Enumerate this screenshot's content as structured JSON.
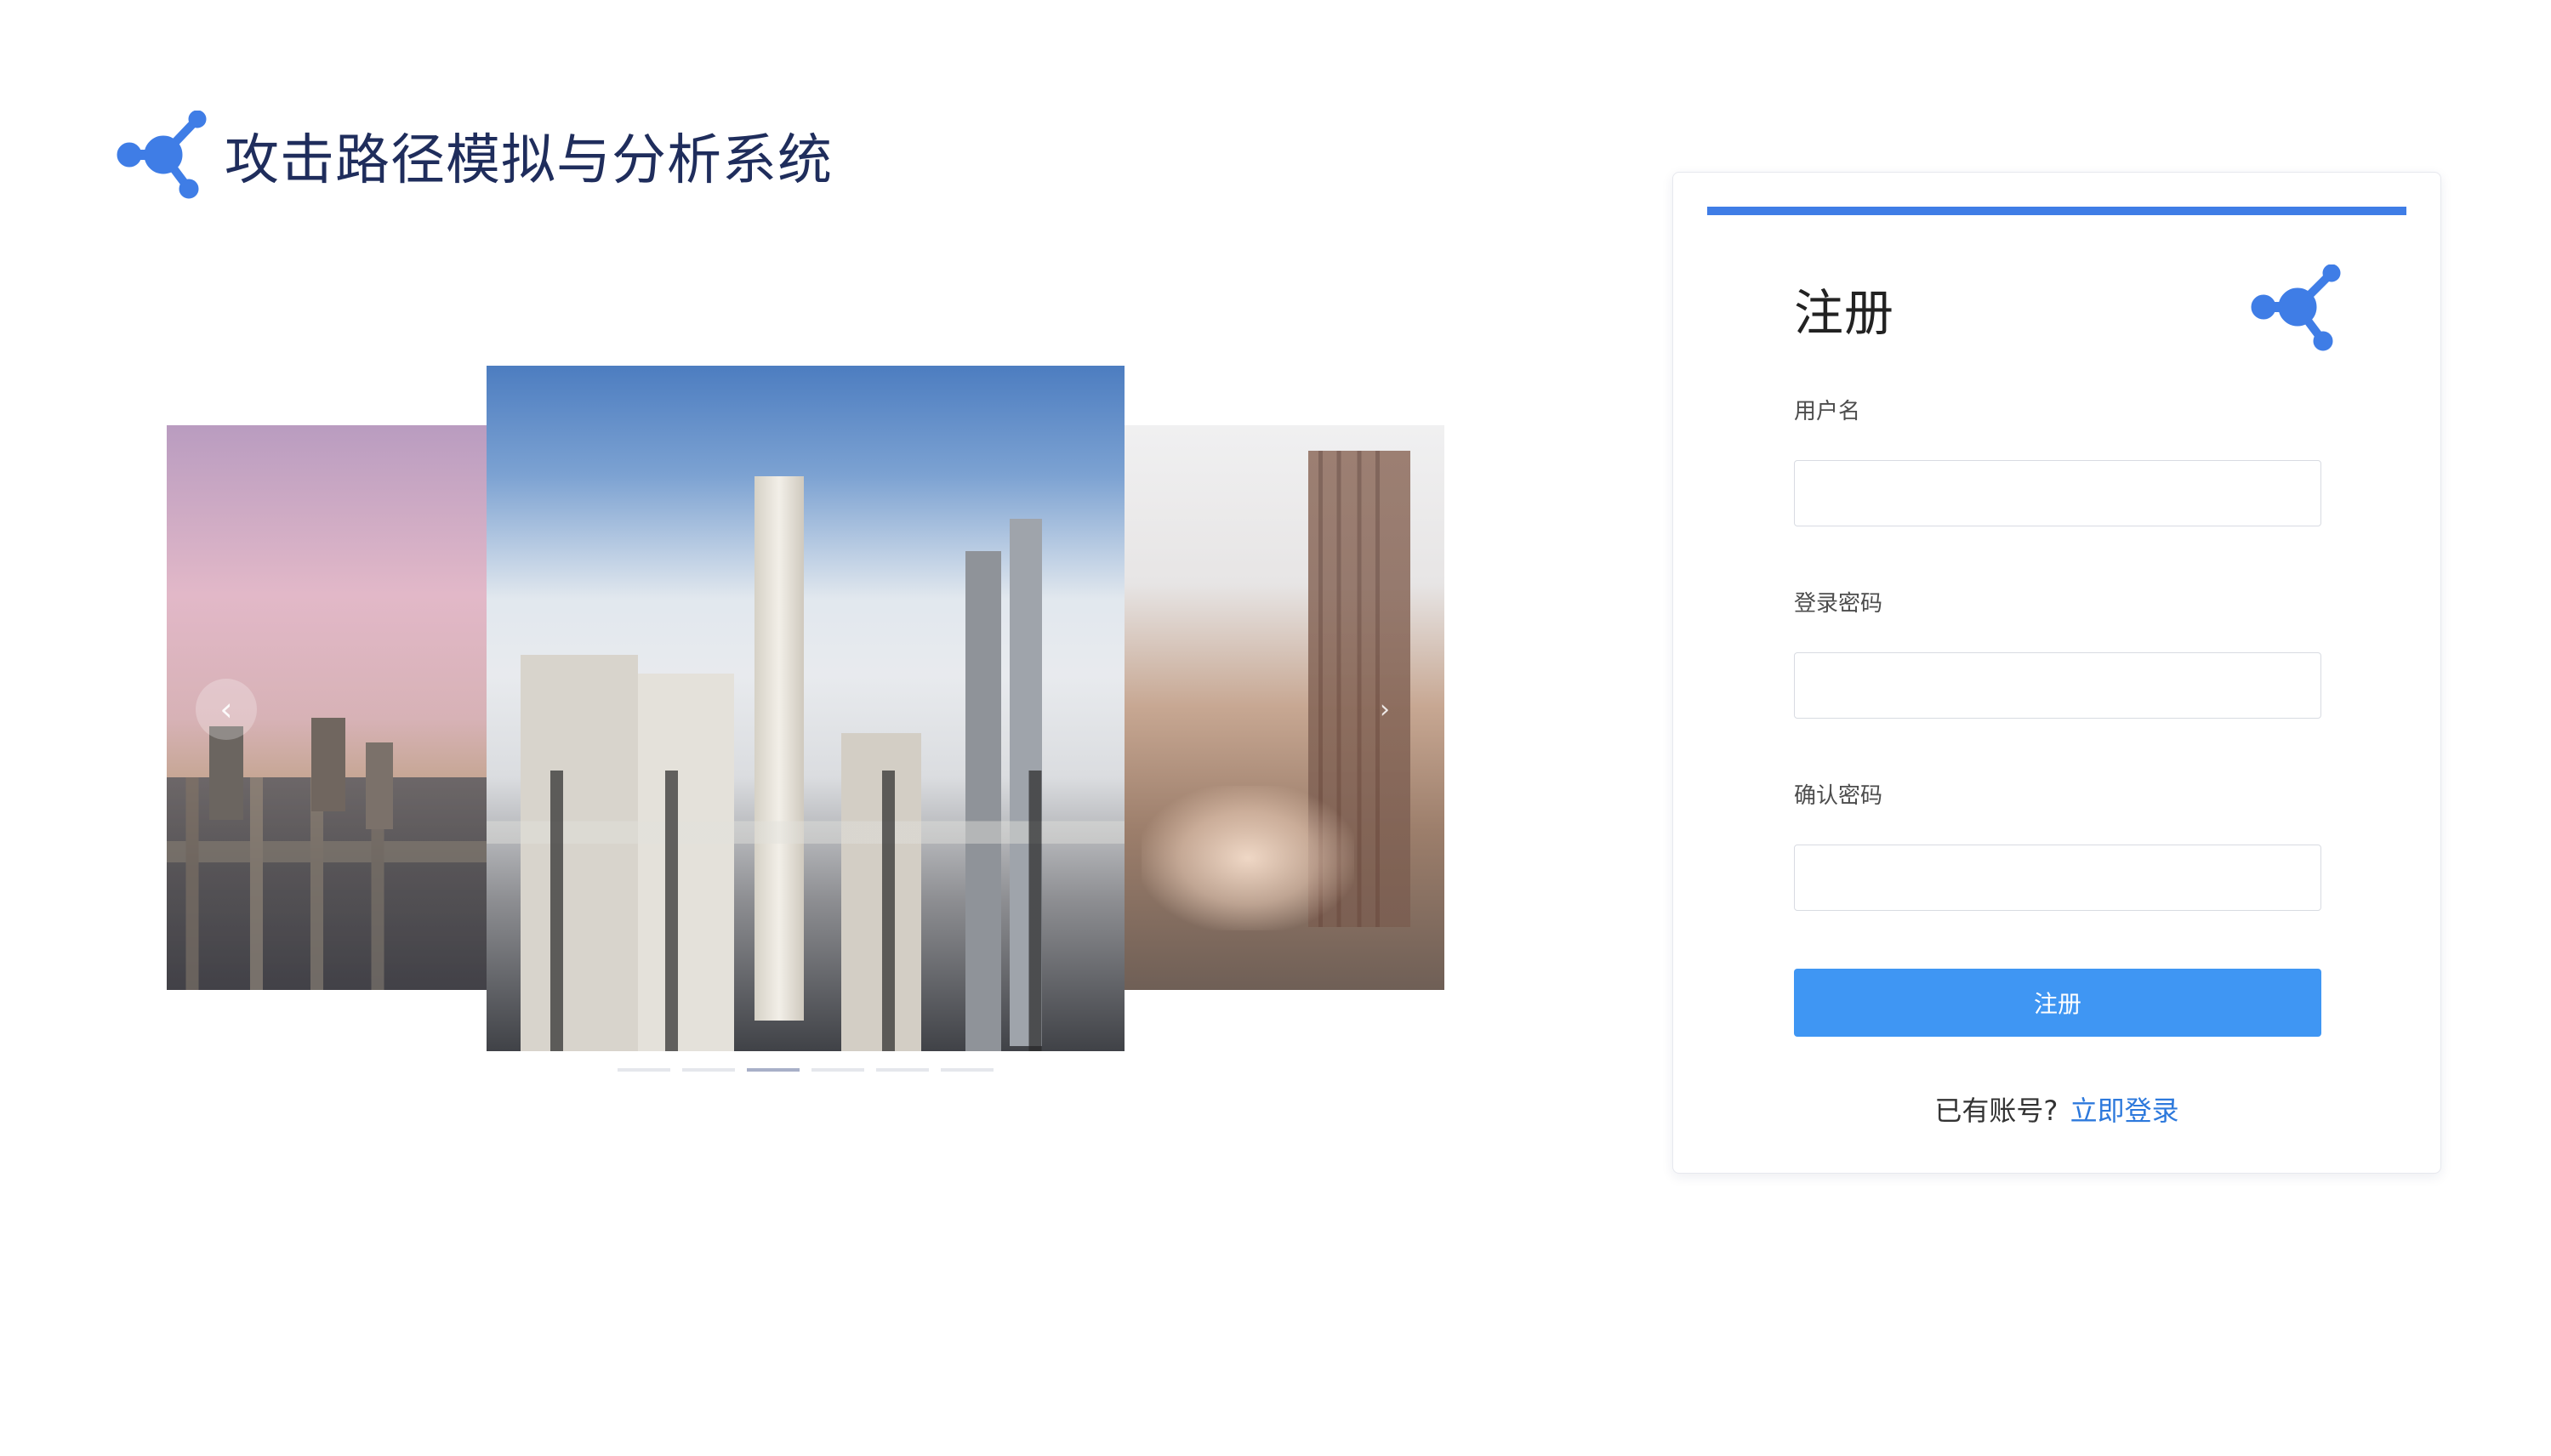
{
  "header": {
    "title": "攻击路径模拟与分析系统",
    "logo_icon": "network-logo-icon",
    "brand_color": "#3f7de6"
  },
  "carousel": {
    "prev_label": "‹",
    "next_label": "›",
    "slides": [
      {
        "name": "industrial-slide-left"
      },
      {
        "name": "industrial-slide-center"
      },
      {
        "name": "industrial-slide-right"
      }
    ],
    "indicators": [
      {
        "active": false
      },
      {
        "active": false
      },
      {
        "active": true
      },
      {
        "active": false
      },
      {
        "active": false
      },
      {
        "active": false
      }
    ]
  },
  "register_form": {
    "title": "注册",
    "username_label": "用户名",
    "username_value": "",
    "password_label": "登录密码",
    "password_value": "",
    "confirm_label": "确认密码",
    "confirm_value": "",
    "submit_label": "注册",
    "login_prompt": "已有账号?",
    "login_link": "立即登录",
    "accent_color": "#3f96f3"
  }
}
